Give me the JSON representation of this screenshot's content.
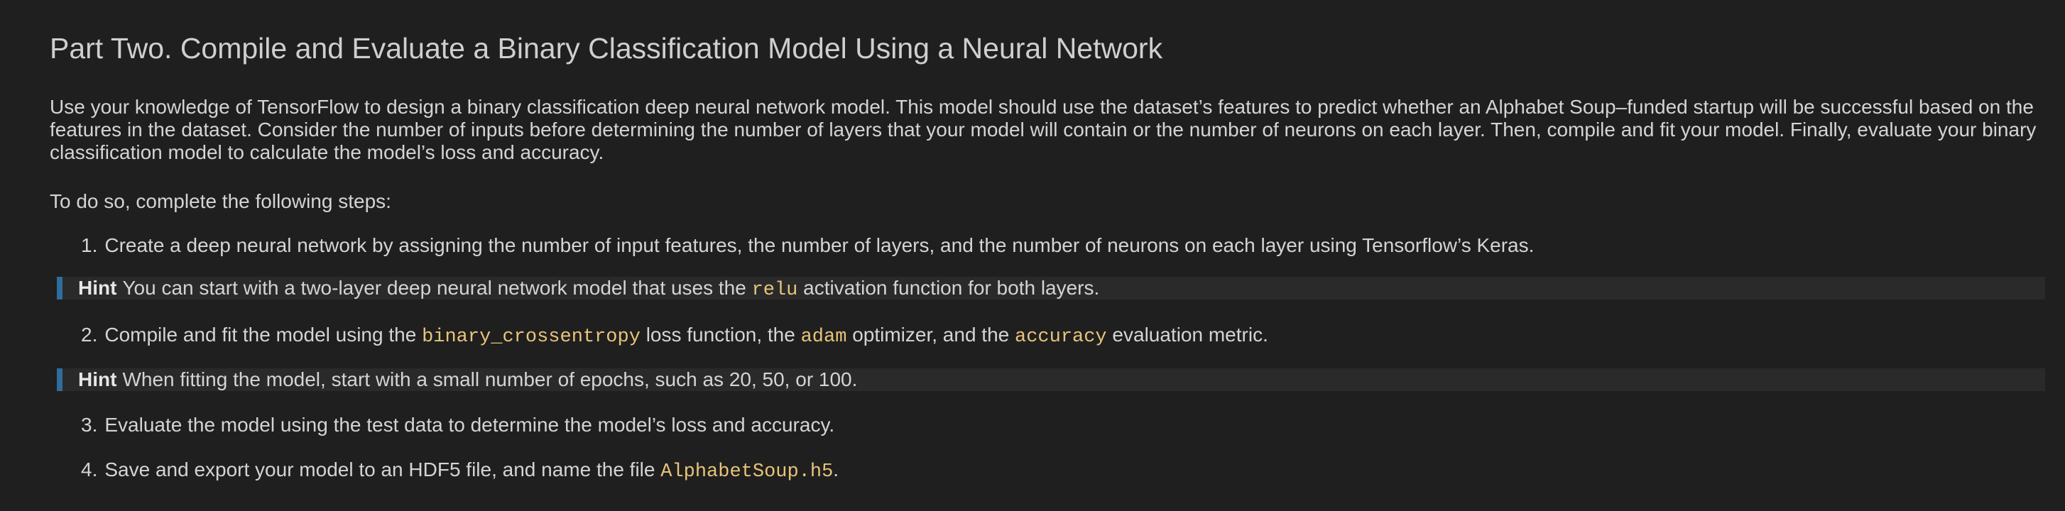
{
  "title": "Part Two. Compile and Evaluate a Binary Classification Model Using a Neural Network",
  "intro": "Use your knowledge of TensorFlow to design a binary classification deep neural network model. This model should use the dataset’s features to predict whether an Alphabet Soup–funded startup will be successful based on the features in the dataset. Consider the number of inputs before determining the number of layers that your model will contain or the number of neurons on each layer. Then, compile and fit your model. Finally, evaluate your binary classification model to calculate the model’s loss and accuracy.",
  "steps_intro": "To do so, complete the following steps:",
  "step1": {
    "num": "1.",
    "text": "Create a deep neural network by assigning the number of input features, the number of layers, and the number of neurons on each layer using Tensorflow’s Keras."
  },
  "hint1": {
    "label": "Hint",
    "pre": "You can start with a two-layer deep neural network model that uses the",
    "code": "relu",
    "post": "activation function for both layers."
  },
  "step2": {
    "num": "2.",
    "pre": "Compile and fit the model using the",
    "code1": "binary_crossentropy",
    "mid1": "loss function, the",
    "code2": "adam",
    "mid2": "optimizer, and the",
    "code3": "accuracy",
    "post": "evaluation metric."
  },
  "hint2": {
    "label": "Hint",
    "text": "When fitting the model, start with a small number of epochs, such as 20, 50, or 100."
  },
  "step3": {
    "num": "3.",
    "text": "Evaluate the model using the test data to determine the model’s loss and accuracy."
  },
  "step4": {
    "num": "4.",
    "pre": "Save and export your model to an HDF5 file, and name the file",
    "code": "AlphabetSoup.h5",
    "post": "."
  }
}
